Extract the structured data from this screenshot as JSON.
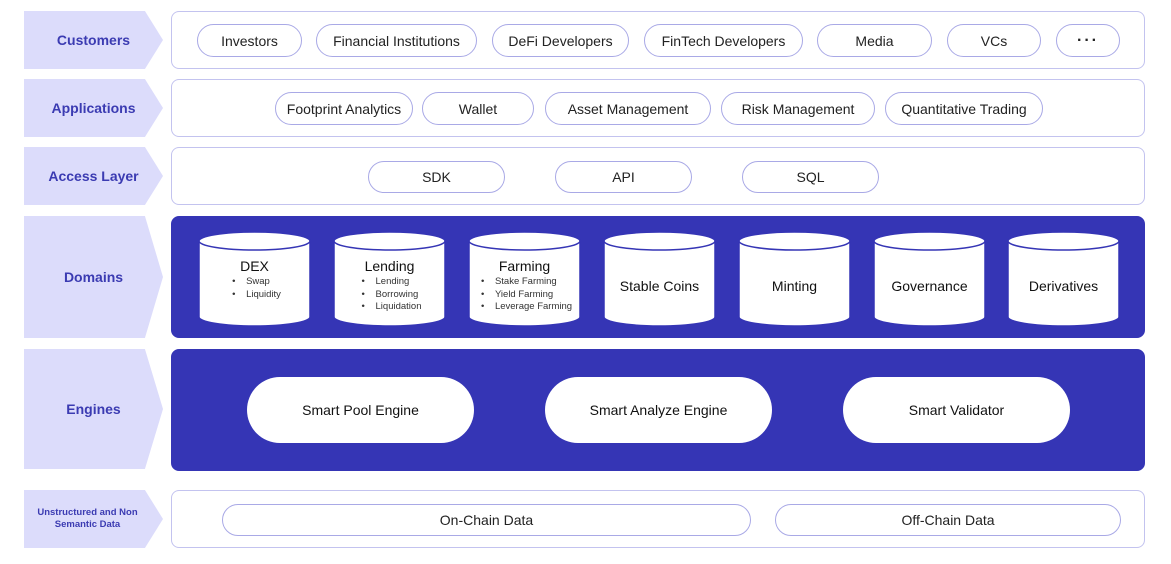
{
  "layers": {
    "customers": {
      "label": "Customers",
      "items": [
        "Investors",
        "Financial Institutions",
        "DeFi Developers",
        "FinTech Developers",
        "Media",
        "VCs",
        "···"
      ]
    },
    "applications": {
      "label": "Applications",
      "items": [
        "Footprint Analytics",
        "Wallet",
        "Asset Management",
        "Risk Management",
        "Quantitative Trading"
      ]
    },
    "access": {
      "label": "Access Layer",
      "items": [
        "SDK",
        "API",
        "SQL"
      ]
    },
    "domains": {
      "label": "Domains",
      "items": [
        {
          "title": "DEX",
          "sub": [
            "Swap",
            "Liquidity"
          ]
        },
        {
          "title": "Lending",
          "sub": [
            "Lending",
            "Borrowing",
            "Liquidation"
          ]
        },
        {
          "title": "Farming",
          "sub": [
            "Stake Farming",
            "Yield Farming",
            "Leverage Farming"
          ]
        },
        {
          "title": "Stable Coins",
          "sub": []
        },
        {
          "title": "Minting",
          "sub": []
        },
        {
          "title": "Governance",
          "sub": []
        },
        {
          "title": "Derivatives",
          "sub": []
        }
      ]
    },
    "engines": {
      "label": "Engines",
      "items": [
        "Smart Pool Engine",
        "Smart Analyze Engine",
        "Smart Validator"
      ]
    },
    "data": {
      "label": "Unstructured and Non Semantic Data",
      "items": [
        "On-Chain Data",
        "Off-Chain Data"
      ]
    }
  },
  "colors": {
    "accent": "#3535b5",
    "label_bg": "#dcdcfb",
    "label_text": "#3b3bb2",
    "pill_border": "#a9a9e6"
  }
}
